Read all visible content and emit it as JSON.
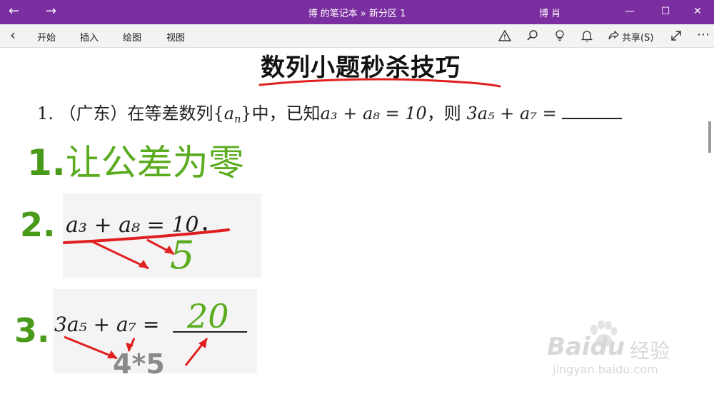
{
  "titlebar": {
    "title": "博 的笔记本 » 新分区 1",
    "user": "博 肖",
    "back_glyph": "←",
    "forward_glyph": "→",
    "min_glyph": "—",
    "max_glyph": "☐",
    "close_glyph": "✕"
  },
  "ribbon": {
    "back_glyph": "‹",
    "tabs": [
      "开始",
      "插入",
      "绘图",
      "视图"
    ],
    "share_label": "共享(S)"
  },
  "note": {
    "title": "数列小题秒杀技巧",
    "question_prefix": "1.   （广东）在等差数列{",
    "question_an": "a",
    "question_an_sub": "n",
    "question_mid": "}中，已知",
    "question_expr1": "a₃ + a₈ = 10",
    "question_then": "，则 ",
    "question_expr2": "3a₅ + a₇ = "
  },
  "steps": {
    "s1_num": "1.",
    "s1_text": "让公差为零",
    "s2_num": "2.",
    "s2_formula": "a₃ + a₈ = 10，",
    "s2_answer": "5",
    "s3_num": "3.",
    "s3_formula": "3a₅ + a₇ = ",
    "s3_answer": "20",
    "s3_multiply": "4*5"
  },
  "watermark": {
    "brand": "Baidu",
    "brand_cn": "经验",
    "url": "jingyan.baidu.com"
  },
  "colors": {
    "titlebar": "#7b2ea0",
    "green": "#4a9a1a",
    "red_ink": "#e02020"
  }
}
